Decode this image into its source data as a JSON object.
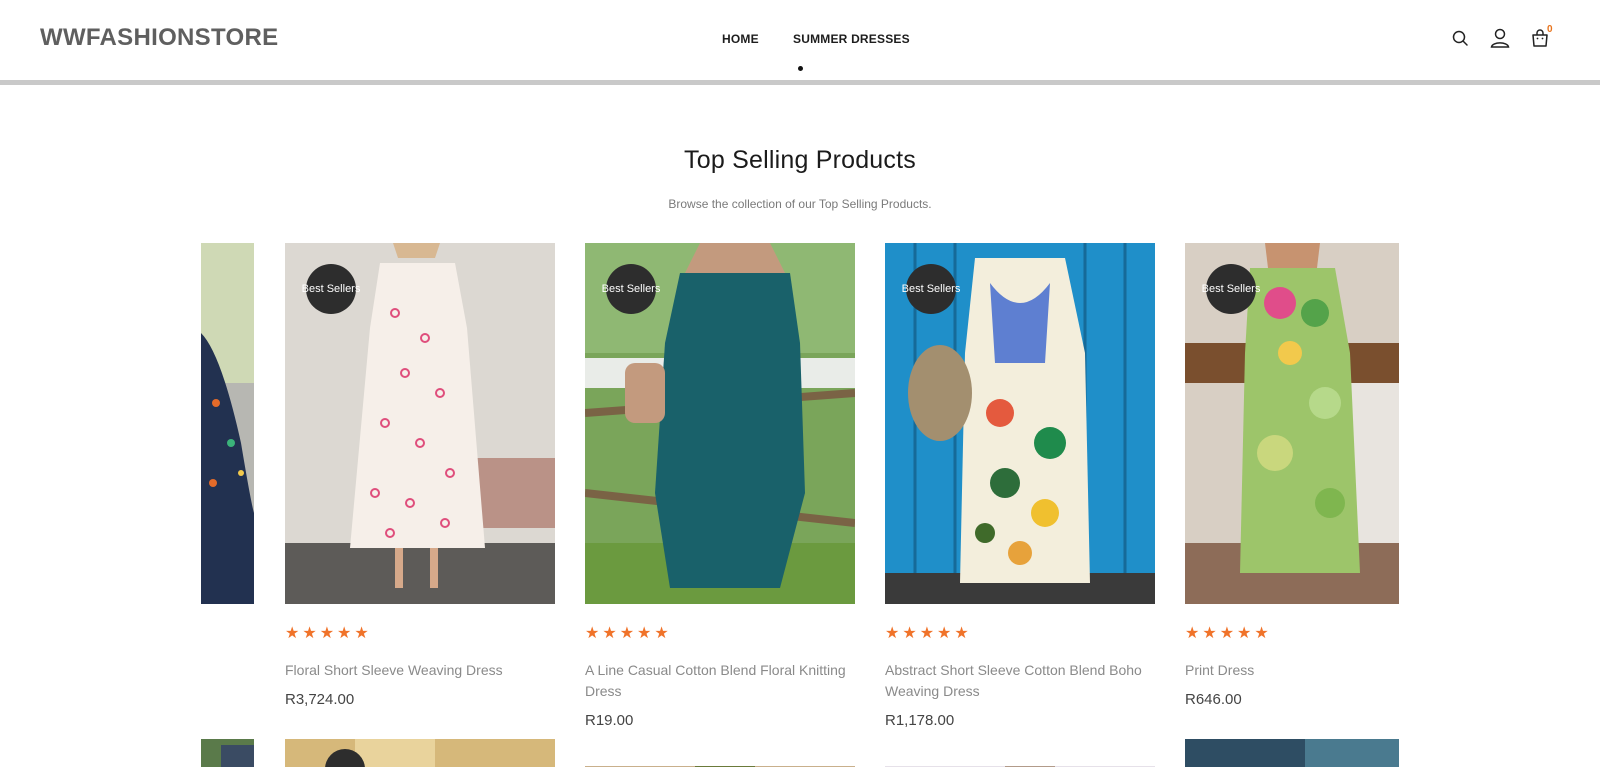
{
  "header": {
    "logo": "WWFASHIONSTORE",
    "nav": [
      {
        "label": "HOME"
      },
      {
        "label": "SUMMER DRESSES"
      }
    ],
    "icons": [
      "search-icon",
      "user-icon",
      "cart-icon"
    ],
    "cart_count": "0"
  },
  "section": {
    "title": "Top Selling Products",
    "subtitle": "Browse the collection of our Top Selling Products."
  },
  "products": [
    {
      "badge": "Best Sellers",
      "rating": "★★★★★",
      "name": "Floral Short Sleeve Weaving Dress",
      "price": "R3,724.00"
    },
    {
      "badge": "Best Sellers",
      "rating": "★★★★★",
      "name": "A Line Casual Cotton Blend Floral Knitting Dress",
      "price": "R19.00"
    },
    {
      "badge": "Best Sellers",
      "rating": "★★★★★",
      "name": "Abstract Short Sleeve Cotton Blend Boho Weaving Dress",
      "price": "R1,178.00"
    },
    {
      "badge": "Best Sellers",
      "rating": "★★★★★",
      "name": "Print Dress",
      "price": "R646.00"
    }
  ],
  "colors": {
    "accent": "#f0732a",
    "badge": "#2d2d2d",
    "logo": "#5f5f5f"
  }
}
